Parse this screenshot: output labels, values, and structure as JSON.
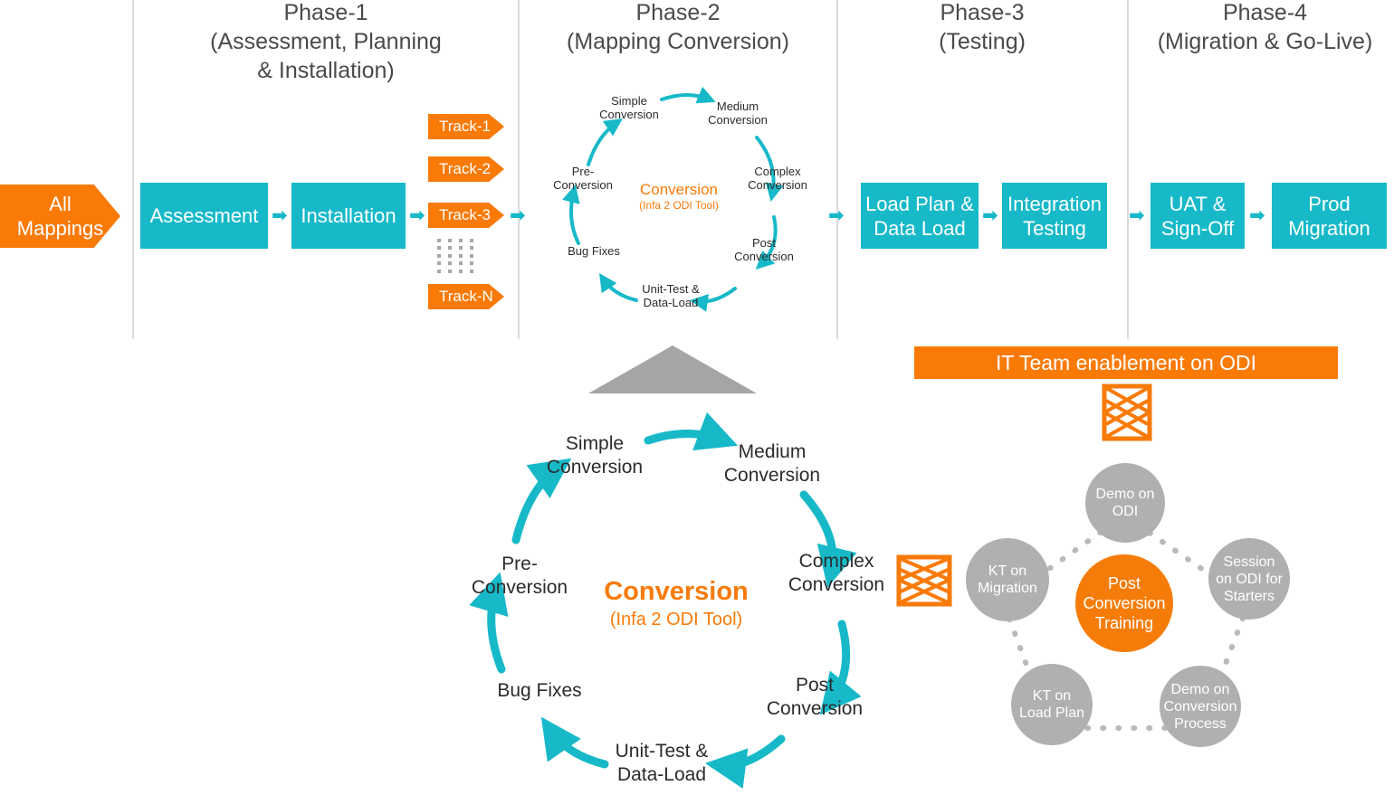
{
  "colors": {
    "teal": "#17b9c9",
    "orange": "#f97a07",
    "gray_circle": "#b0b0b0",
    "divider": "#dcdcdc",
    "triangle": "#a5a5a5",
    "text_dark": "#3c3c3c"
  },
  "entry": {
    "label": "All\nMappings",
    "line1": "All",
    "line2": "Mappings"
  },
  "phases": [
    {
      "id": "phase-1",
      "title_line1": "Phase-1",
      "title_line2": "(Assessment, Planning",
      "title_line3": "& Installation)"
    },
    {
      "id": "phase-2",
      "title_line1": "Phase-2",
      "title_line2": "(Mapping Conversion)",
      "title_line3": ""
    },
    {
      "id": "phase-3",
      "title_line1": "Phase-3",
      "title_line2": "(Testing)",
      "title_line3": ""
    },
    {
      "id": "phase-4",
      "title_line1": "Phase-4",
      "title_line2": "(Migration & Go-Live)",
      "title_line3": ""
    }
  ],
  "boxes": {
    "assessment": "Assessment",
    "installation": "Installation",
    "load_plan_l1": "Load Plan &",
    "load_plan_l2": "Data Load",
    "integration_l1": "Integration",
    "integration_l2": "Testing",
    "uat_l1": "UAT &",
    "uat_l2": "Sign-Off",
    "prod_l1": "Prod",
    "prod_l2": "Migration"
  },
  "tracks": [
    {
      "label": "Track-1"
    },
    {
      "label": "Track-2"
    },
    {
      "label": "Track-3"
    },
    {
      "label": "Track-N"
    }
  ],
  "arrow_glyph": "➡",
  "cycle_small": {
    "center_title": "Conversion",
    "center_subtitle": "(Infa 2 ODI Tool)",
    "nodes": [
      {
        "id": "simple",
        "line1": "Simple",
        "line2": "Conversion"
      },
      {
        "id": "medium",
        "line1": "Medium",
        "line2": "Conversion"
      },
      {
        "id": "complex",
        "line1": "Complex",
        "line2": "Conversion"
      },
      {
        "id": "post",
        "line1": "Post",
        "line2": "Conversion"
      },
      {
        "id": "unittest",
        "line1": "Unit-Test &",
        "line2": "Data-Load"
      },
      {
        "id": "bugfixes",
        "line1": "Bug Fixes",
        "line2": ""
      },
      {
        "id": "pre",
        "line1": "Pre-",
        "line2": "Conversion"
      }
    ]
  },
  "cycle_large": {
    "center_title": "Conversion",
    "center_subtitle": "(Infa 2 ODI Tool)",
    "nodes": [
      {
        "id": "simple",
        "line1": "Simple",
        "line2": "Conversion"
      },
      {
        "id": "medium",
        "line1": "Medium",
        "line2": "Conversion"
      },
      {
        "id": "complex",
        "line1": "Complex",
        "line2": "Conversion"
      },
      {
        "id": "post",
        "line1": "Post",
        "line2": "Conversion"
      },
      {
        "id": "unittest",
        "line1": "Unit-Test &",
        "line2": "Data-Load"
      },
      {
        "id": "bugfixes",
        "line1": "Bug Fixes",
        "line2": ""
      },
      {
        "id": "pre",
        "line1": "Pre-",
        "line2": "Conversion"
      }
    ]
  },
  "enablement": {
    "banner": "IT Team enablement on ODI",
    "center": {
      "line1": "Post",
      "line2": "Conversion",
      "line3": "Training"
    },
    "nodes": [
      {
        "id": "demo-odi",
        "line1": "Demo on",
        "line2": "ODI",
        "line3": ""
      },
      {
        "id": "session-odi",
        "line1": "Session",
        "line2": "on ODI for",
        "line3": "Starters"
      },
      {
        "id": "demo-conv-process",
        "line1": "Demo on",
        "line2": "Conversion",
        "line3": "Process"
      },
      {
        "id": "kt-load-plan",
        "line1": "KT on",
        "line2": "Load Plan",
        "line3": ""
      },
      {
        "id": "kt-migration",
        "line1": "KT on",
        "line2": "Migration",
        "line3": ""
      }
    ]
  },
  "callouts": [
    {
      "id": "callout-cycle-zoom",
      "orientation": "vertical"
    },
    {
      "id": "callout-enablement-zoom",
      "orientation": "horizontal"
    }
  ]
}
